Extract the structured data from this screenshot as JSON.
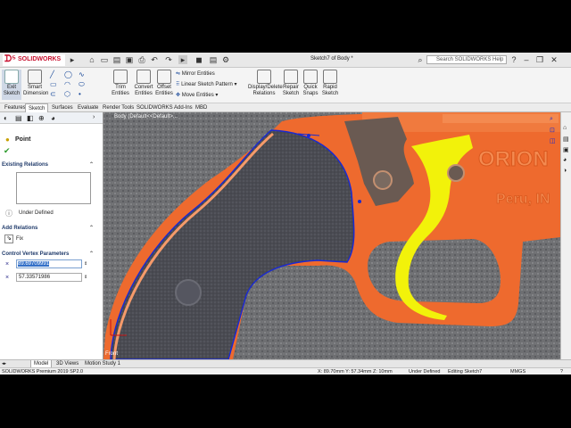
{
  "app": {
    "logo": "SOLIDWORKS",
    "doc_title": "Sketch7 of Body *",
    "search_placeholder": "Search SOLIDWORKS Help"
  },
  "ribbon": {
    "exit_sketch": "Exit Sketch",
    "smart_dimension": "Smart Dimension",
    "trim_entities": "Trim Entities",
    "convert_entities": "Convert Entities",
    "offset_entities": "Offset Entities",
    "mirror_entities": "Mirror Entities",
    "linear_pattern": "Linear Sketch Pattern",
    "move_entities": "Move Entities",
    "display_delete": "Display/Delete Relations",
    "repair_sketch": "Repair Sketch",
    "quick_snaps": "Quick Snaps",
    "rapid_sketch": "Rapid Sketch"
  },
  "command_tabs": [
    "Features",
    "Sketch",
    "Surfaces",
    "Evaluate",
    "Render Tools",
    "SOLIDWORKS Add-Ins",
    "MBD"
  ],
  "left_panel": {
    "point_title": "Point",
    "existing_relations": "Existing Relations",
    "under_defined": "Under Defined",
    "add_relations": "Add Relations",
    "fix": "Fix",
    "control_vertex": "Control Vertex Parameters",
    "x_value": "89.69709991",
    "y_value": "57.33571986"
  },
  "viewport": {
    "tree_label": "Body (Default<<Default>...",
    "front_label": "Front"
  },
  "model_tabs": [
    "Model",
    "3D Views",
    "Motion Study 1"
  ],
  "status": {
    "version": "SOLIDWORKS Premium 2019 SP2.0",
    "coords": "X: 89.70mm Y: 57.34mm Z: 10mm",
    "defined": "Under Defined",
    "editing": "Editing Sketch7",
    "units": "MMGS"
  },
  "colors": {
    "gun_orange": "#ee6a2e",
    "grip_dark": "#4a4b52",
    "trigger_yellow": "#f2f20a",
    "sketch_blue": "#1a2ad0",
    "brand_red": "#c8102e"
  }
}
